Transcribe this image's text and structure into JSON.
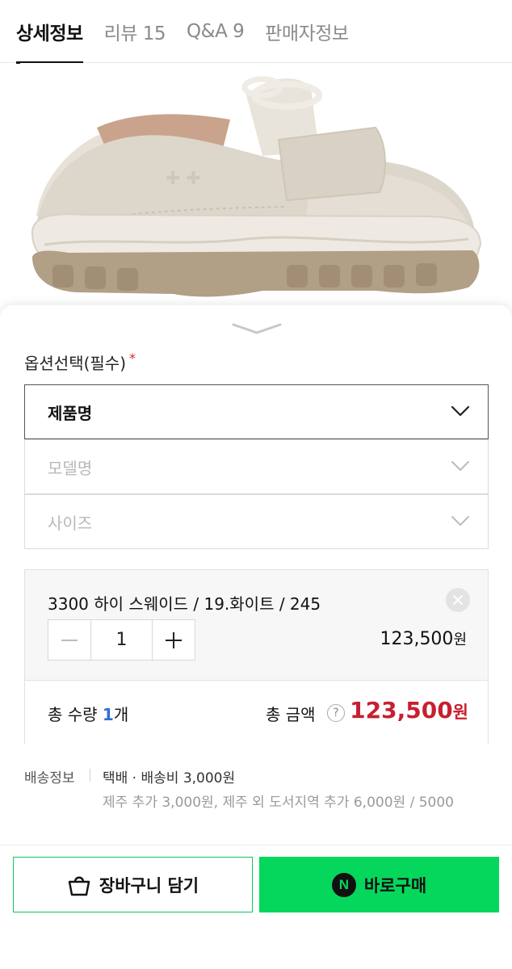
{
  "tabs": [
    {
      "label": "상세정보",
      "active": true
    },
    {
      "label": "리뷰 15",
      "active": false
    },
    {
      "label": "Q&A 9",
      "active": false
    },
    {
      "label": "판매자정보",
      "active": false
    }
  ],
  "product_image": {
    "icon": "sneaker-image"
  },
  "options": {
    "title": "옵션선택(필수)",
    "required_mark": "*",
    "selects": [
      {
        "label": "제품명",
        "state": "active"
      },
      {
        "label": "모델명",
        "state": "disabled"
      },
      {
        "label": "사이즈",
        "state": "disabled"
      }
    ]
  },
  "selected_item": {
    "name": "3300 하이 스웨이드 / 19.화이트 / 245",
    "quantity": "1",
    "price": "123,500",
    "price_unit": "원"
  },
  "total": {
    "qty_prefix": "총 수량 ",
    "qty_num": "1",
    "qty_suffix": "개",
    "amount_label": "총 금액",
    "help": "?",
    "amount": "123,500",
    "amount_unit": "원"
  },
  "shipping": {
    "label": "배송정보",
    "main": "택배 · 배송비 3,000원",
    "sub": "제주 추가 3,000원, 제주 외 도서지역 추가 6,000원 / 5000"
  },
  "actions": {
    "cart_label": "장바구니 담기",
    "buy_label": "바로구매",
    "buy_logo": "N"
  },
  "colors": {
    "accent_green": "#05d75c",
    "price_red": "#c81f31",
    "qty_blue": "#2f6fd9"
  }
}
